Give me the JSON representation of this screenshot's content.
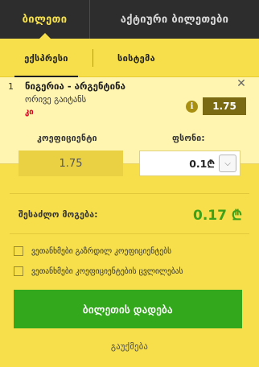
{
  "top_tabs": [
    {
      "label": "ბილეთი",
      "active": true
    },
    {
      "label": "აქტიური ბილეთები",
      "active": false
    }
  ],
  "sub_tabs": [
    {
      "label": "ექსპრესი",
      "active": true
    },
    {
      "label": "სისტემა",
      "active": false
    }
  ],
  "bet": {
    "number": "1",
    "title": "ნიგერია - არგენტინა",
    "market": "ორივე გაიტანს",
    "pick": "კი",
    "odds": "1.75",
    "info_icon": "info-icon",
    "close_icon": "close-icon"
  },
  "slip": {
    "coef_label": "კოეფიციენტი",
    "coef_value": "1.75",
    "stake_label": "ფსონი:",
    "stake_value": "0.1",
    "currency_symbol": "₾",
    "possible_win_label": "შესაძლო მოგება:",
    "possible_win_value": "0.17 ₾"
  },
  "options": [
    {
      "label": "ვეთანხმები გაზრდილ კოეფიციენტებს",
      "checked": false
    },
    {
      "label": "ვეთანხმები კოეფიციენტების ცვლილებას",
      "checked": false
    }
  ],
  "actions": {
    "place_bet": "ბილეთის დადება",
    "cancel": "გაუქმება"
  },
  "colors": {
    "accent_yellow": "#f6df4a",
    "place_bet_green": "#33a81d",
    "win_green": "#3ea11a",
    "pick_red": "#d0021b"
  }
}
